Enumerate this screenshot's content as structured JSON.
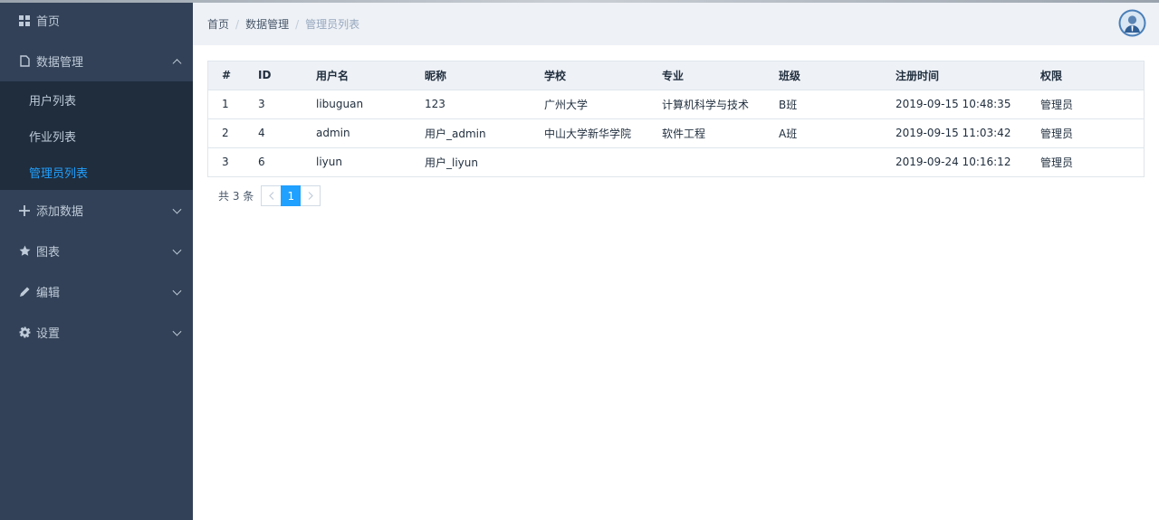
{
  "sidebar": {
    "home": {
      "label": "首页"
    },
    "data_mgmt": {
      "label": "数据管理",
      "children": [
        {
          "label": "用户列表"
        },
        {
          "label": "作业列表"
        },
        {
          "label": "管理员列表"
        }
      ]
    },
    "add_data": {
      "label": "添加数据"
    },
    "charts": {
      "label": "图表"
    },
    "edit": {
      "label": "编辑"
    },
    "settings": {
      "label": "设置"
    }
  },
  "breadcrumb": [
    "首页",
    "数据管理",
    "管理员列表"
  ],
  "table": {
    "columns": [
      "#",
      "ID",
      "用户名",
      "昵称",
      "学校",
      "专业",
      "班级",
      "注册时间",
      "权限"
    ],
    "rows": [
      [
        "1",
        "3",
        "libuguan",
        "123",
        "广州大学",
        "计算机科学与技术",
        "B班",
        "2019-09-15 10:48:35",
        "管理员"
      ],
      [
        "2",
        "4",
        "admin",
        "用户_admin",
        "中山大学新华学院",
        "软件工程",
        "A班",
        "2019-09-15 11:03:42",
        "管理员"
      ],
      [
        "3",
        "6",
        "liyun",
        "用户_liyun",
        "",
        "",
        "",
        "2019-09-24 10:16:12",
        "管理员"
      ]
    ]
  },
  "pagination": {
    "total": "共 3 条",
    "current": "1"
  },
  "colors": {
    "sidebar_bg": "#324157",
    "submenu_bg": "#1f2d3d",
    "accent": "#20a0ff",
    "header_bg": "#eef1f6"
  }
}
